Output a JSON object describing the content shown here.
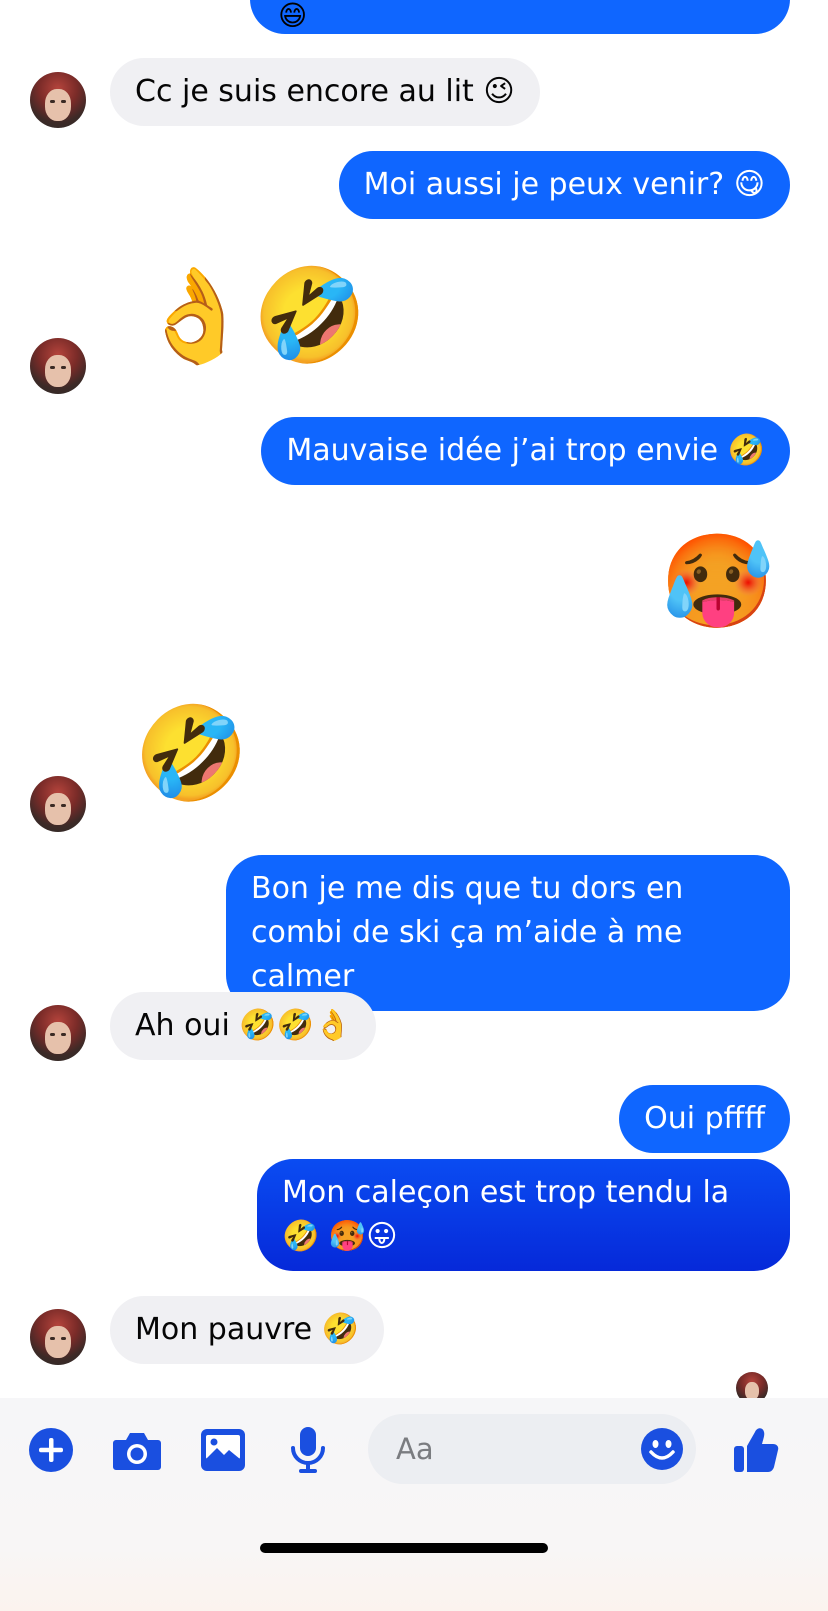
{
  "conversation": {
    "messages": [
      {
        "side": "in",
        "text": "Cc je suis encore au lit 😉"
      },
      {
        "side": "out",
        "text": "Moi aussi je peux venir? 😋"
      },
      {
        "side": "in",
        "text": "👌🤣"
      },
      {
        "side": "out",
        "text": "Mauvaise idée j’ai trop envie 🤣"
      },
      {
        "side": "out",
        "text": "🥵"
      },
      {
        "side": "in",
        "text": "🤣"
      },
      {
        "side": "out",
        "text": "Bon je me dis que tu dors en combi de ski ça m’aide à me calmer"
      },
      {
        "side": "in",
        "text": "Ah oui 🤣🤣👌"
      },
      {
        "side": "out",
        "text": "Oui pffff"
      },
      {
        "side": "out",
        "text": "Mon caleçon est trop tendu la 🤣 🥵😛"
      },
      {
        "side": "in",
        "text": "Mon pauvre 🤣"
      }
    ]
  },
  "composer": {
    "placeholder": "Aa",
    "icons": [
      "add-icon",
      "camera-icon",
      "image-icon",
      "microphone-icon",
      "emoji-icon",
      "thumbs-up-icon"
    ]
  },
  "colors": {
    "accent": "#0f66ff",
    "incoming_bubble": "#f0f0f3",
    "icon_blue": "#1a4fe0"
  }
}
